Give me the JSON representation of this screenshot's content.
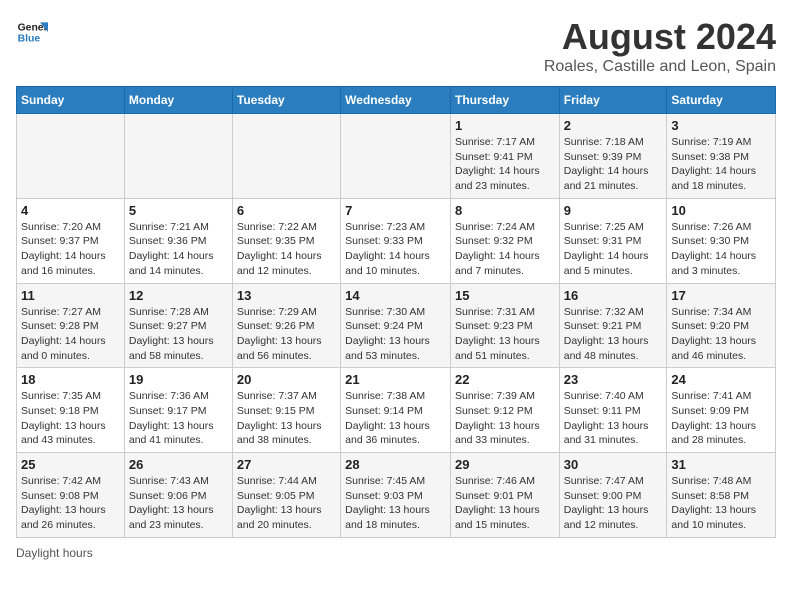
{
  "logo": {
    "line1": "General",
    "line2": "Blue"
  },
  "title": "August 2024",
  "subtitle": "Roales, Castille and Leon, Spain",
  "days_of_week": [
    "Sunday",
    "Monday",
    "Tuesday",
    "Wednesday",
    "Thursday",
    "Friday",
    "Saturday"
  ],
  "footer": "Daylight hours",
  "weeks": [
    [
      {
        "day": "",
        "info": ""
      },
      {
        "day": "",
        "info": ""
      },
      {
        "day": "",
        "info": ""
      },
      {
        "day": "",
        "info": ""
      },
      {
        "day": "1",
        "info": "Sunrise: 7:17 AM\nSunset: 9:41 PM\nDaylight: 14 hours and 23 minutes."
      },
      {
        "day": "2",
        "info": "Sunrise: 7:18 AM\nSunset: 9:39 PM\nDaylight: 14 hours and 21 minutes."
      },
      {
        "day": "3",
        "info": "Sunrise: 7:19 AM\nSunset: 9:38 PM\nDaylight: 14 hours and 18 minutes."
      }
    ],
    [
      {
        "day": "4",
        "info": "Sunrise: 7:20 AM\nSunset: 9:37 PM\nDaylight: 14 hours and 16 minutes."
      },
      {
        "day": "5",
        "info": "Sunrise: 7:21 AM\nSunset: 9:36 PM\nDaylight: 14 hours and 14 minutes."
      },
      {
        "day": "6",
        "info": "Sunrise: 7:22 AM\nSunset: 9:35 PM\nDaylight: 14 hours and 12 minutes."
      },
      {
        "day": "7",
        "info": "Sunrise: 7:23 AM\nSunset: 9:33 PM\nDaylight: 14 hours and 10 minutes."
      },
      {
        "day": "8",
        "info": "Sunrise: 7:24 AM\nSunset: 9:32 PM\nDaylight: 14 hours and 7 minutes."
      },
      {
        "day": "9",
        "info": "Sunrise: 7:25 AM\nSunset: 9:31 PM\nDaylight: 14 hours and 5 minutes."
      },
      {
        "day": "10",
        "info": "Sunrise: 7:26 AM\nSunset: 9:30 PM\nDaylight: 14 hours and 3 minutes."
      }
    ],
    [
      {
        "day": "11",
        "info": "Sunrise: 7:27 AM\nSunset: 9:28 PM\nDaylight: 14 hours and 0 minutes."
      },
      {
        "day": "12",
        "info": "Sunrise: 7:28 AM\nSunset: 9:27 PM\nDaylight: 13 hours and 58 minutes."
      },
      {
        "day": "13",
        "info": "Sunrise: 7:29 AM\nSunset: 9:26 PM\nDaylight: 13 hours and 56 minutes."
      },
      {
        "day": "14",
        "info": "Sunrise: 7:30 AM\nSunset: 9:24 PM\nDaylight: 13 hours and 53 minutes."
      },
      {
        "day": "15",
        "info": "Sunrise: 7:31 AM\nSunset: 9:23 PM\nDaylight: 13 hours and 51 minutes."
      },
      {
        "day": "16",
        "info": "Sunrise: 7:32 AM\nSunset: 9:21 PM\nDaylight: 13 hours and 48 minutes."
      },
      {
        "day": "17",
        "info": "Sunrise: 7:34 AM\nSunset: 9:20 PM\nDaylight: 13 hours and 46 minutes."
      }
    ],
    [
      {
        "day": "18",
        "info": "Sunrise: 7:35 AM\nSunset: 9:18 PM\nDaylight: 13 hours and 43 minutes."
      },
      {
        "day": "19",
        "info": "Sunrise: 7:36 AM\nSunset: 9:17 PM\nDaylight: 13 hours and 41 minutes."
      },
      {
        "day": "20",
        "info": "Sunrise: 7:37 AM\nSunset: 9:15 PM\nDaylight: 13 hours and 38 minutes."
      },
      {
        "day": "21",
        "info": "Sunrise: 7:38 AM\nSunset: 9:14 PM\nDaylight: 13 hours and 36 minutes."
      },
      {
        "day": "22",
        "info": "Sunrise: 7:39 AM\nSunset: 9:12 PM\nDaylight: 13 hours and 33 minutes."
      },
      {
        "day": "23",
        "info": "Sunrise: 7:40 AM\nSunset: 9:11 PM\nDaylight: 13 hours and 31 minutes."
      },
      {
        "day": "24",
        "info": "Sunrise: 7:41 AM\nSunset: 9:09 PM\nDaylight: 13 hours and 28 minutes."
      }
    ],
    [
      {
        "day": "25",
        "info": "Sunrise: 7:42 AM\nSunset: 9:08 PM\nDaylight: 13 hours and 26 minutes."
      },
      {
        "day": "26",
        "info": "Sunrise: 7:43 AM\nSunset: 9:06 PM\nDaylight: 13 hours and 23 minutes."
      },
      {
        "day": "27",
        "info": "Sunrise: 7:44 AM\nSunset: 9:05 PM\nDaylight: 13 hours and 20 minutes."
      },
      {
        "day": "28",
        "info": "Sunrise: 7:45 AM\nSunset: 9:03 PM\nDaylight: 13 hours and 18 minutes."
      },
      {
        "day": "29",
        "info": "Sunrise: 7:46 AM\nSunset: 9:01 PM\nDaylight: 13 hours and 15 minutes."
      },
      {
        "day": "30",
        "info": "Sunrise: 7:47 AM\nSunset: 9:00 PM\nDaylight: 13 hours and 12 minutes."
      },
      {
        "day": "31",
        "info": "Sunrise: 7:48 AM\nSunset: 8:58 PM\nDaylight: 13 hours and 10 minutes."
      }
    ]
  ]
}
